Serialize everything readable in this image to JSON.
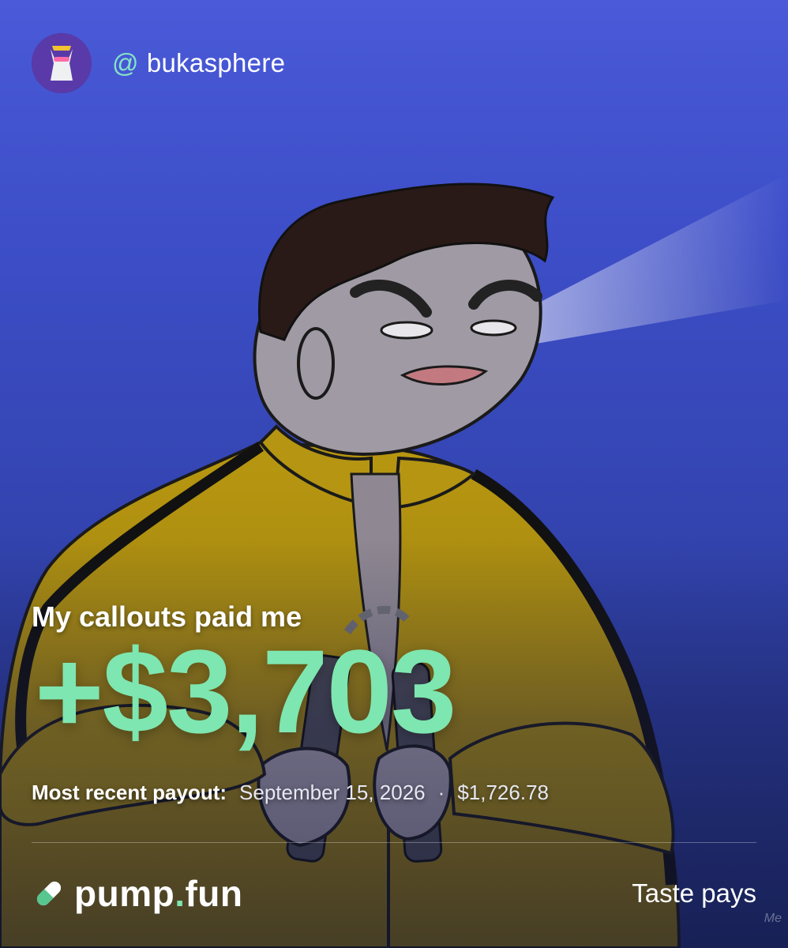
{
  "user": {
    "at_symbol": "@",
    "handle": "bukasphere",
    "avatar_icon": "wolf-avatar-icon"
  },
  "headline": "My callouts paid me",
  "amount": "+$3,703",
  "payout": {
    "label": "Most recent payout:",
    "date": "September 15, 2026",
    "separator": "·",
    "value": "$1,726.78"
  },
  "brand": {
    "logo_icon": "pill-icon",
    "name_part1": "pump",
    "name_dot": ".",
    "name_part2": "fun"
  },
  "tagline": "Taste pays",
  "watermark": "Me",
  "colors": {
    "accent": "#7ee6b0",
    "background": "#3d4ec8",
    "suit_yellow": "#c9a313"
  }
}
